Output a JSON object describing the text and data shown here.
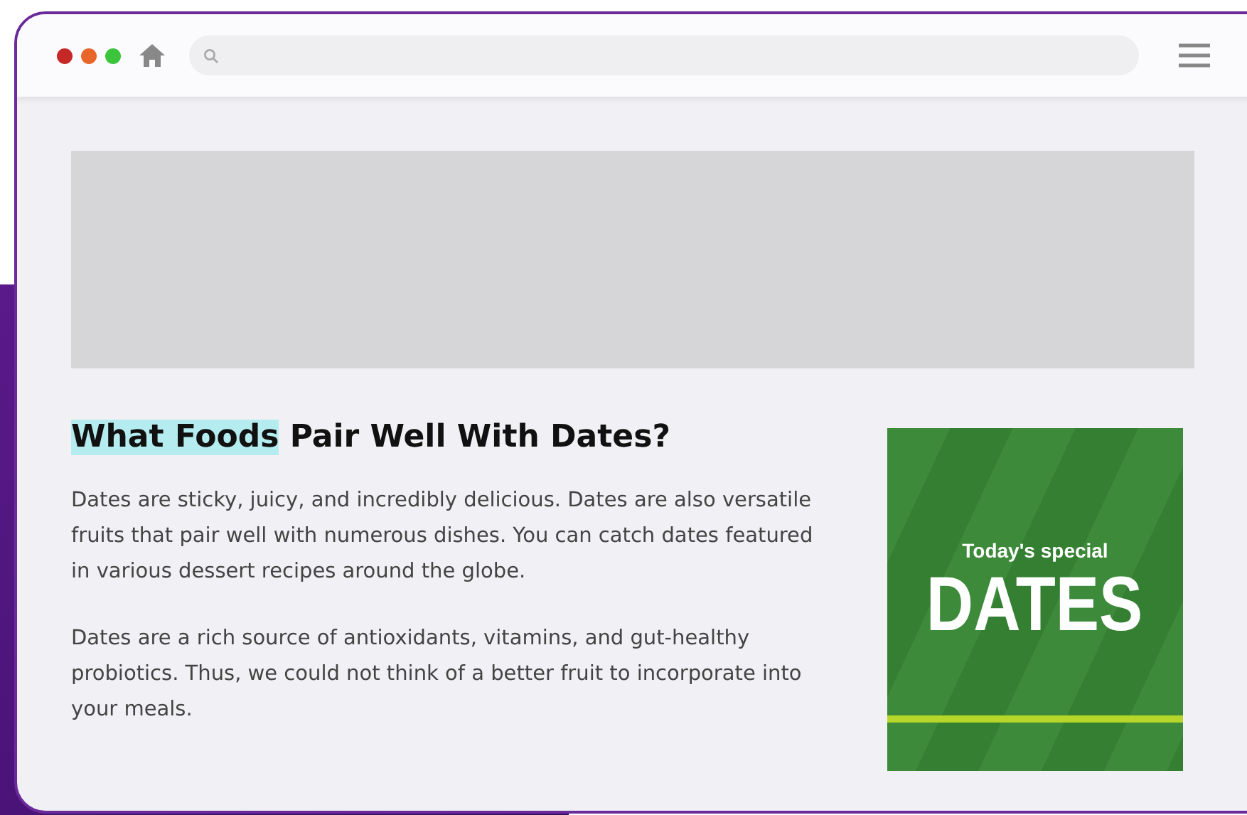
{
  "browser": {
    "window_controls": [
      {
        "color": "#c62828"
      },
      {
        "color": "#e8662a"
      },
      {
        "color": "#3cc43c"
      }
    ]
  },
  "article": {
    "heading": {
      "highlighted": "What Foods",
      "rest": " Pair Well With Dates?"
    },
    "paragraphs": [
      "Dates are sticky, juicy, and incredibly delicious. Dates are also versatile fruits that pair well with numerous dishes. You can catch dates featured in various dessert recipes around the globe.",
      "Dates are a rich source of antioxidants, vitamins, and gut-healthy probiotics. Thus, we could not think of a better fruit to incorporate into your meals."
    ],
    "promo": {
      "subtitle": "Today's special",
      "title": "DATES"
    }
  }
}
